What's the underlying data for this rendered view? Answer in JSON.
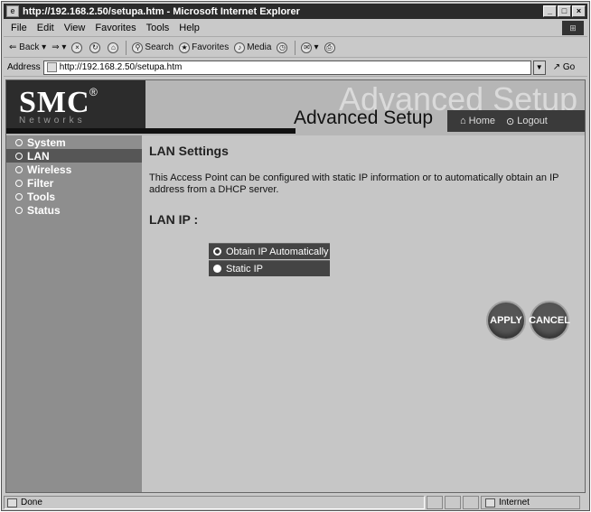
{
  "window": {
    "title": "http://192.168.2.50/setupa.htm - Microsoft Internet Explorer",
    "controls": [
      "_",
      "□",
      "×"
    ]
  },
  "menu": [
    "File",
    "Edit",
    "View",
    "Favorites",
    "Tools",
    "Help"
  ],
  "toolbar": {
    "back": "Back",
    "search": "Search",
    "favorites": "Favorites",
    "media": "Media"
  },
  "address": {
    "label": "Address",
    "url": "http://192.168.2.50/setupa.htm",
    "go": "Go"
  },
  "banner": {
    "logo": "SMC",
    "logo_reg": "®",
    "logo_sub": "Networks",
    "ghost_title": "Advanced Setup",
    "title": "Advanced Setup",
    "home": "Home",
    "logout": "Logout"
  },
  "sidebar": {
    "items": [
      {
        "label": "System"
      },
      {
        "label": "LAN"
      },
      {
        "label": "Wireless"
      },
      {
        "label": "Filter"
      },
      {
        "label": "Tools"
      },
      {
        "label": "Status"
      }
    ],
    "active": "LAN"
  },
  "content": {
    "title": "LAN Settings",
    "description": "This Access Point can be configured with static IP information or to automatically obtain an IP address from a DHCP server.",
    "lan_ip_label": "LAN IP :",
    "options": [
      {
        "label": "Obtain IP Automatically",
        "selected": true
      },
      {
        "label": "Static IP",
        "selected": false
      }
    ],
    "apply": "APPLY",
    "cancel": "CANCEL"
  },
  "status": {
    "text": "Done",
    "zone": "Internet"
  },
  "colors": {
    "title_bar": "#2b2b2b",
    "sidebar": "#8e8e8e",
    "sidebar_active": "#565656",
    "content_bg": "#c6c6c6",
    "option_bg": "#444444"
  }
}
